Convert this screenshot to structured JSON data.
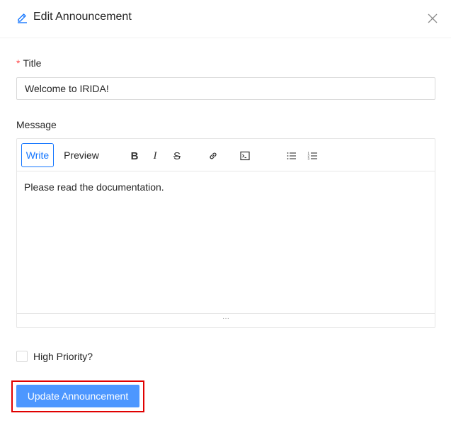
{
  "modal": {
    "title": "Edit Announcement",
    "icons": {
      "edit": "edit-pencil-icon",
      "close": "close-icon"
    }
  },
  "form": {
    "title_label": "Title",
    "title_required_mark": "*",
    "title_value": "Welcome to IRIDA!",
    "message_label": "Message",
    "editor": {
      "tabs": [
        "Write",
        "Preview"
      ],
      "active_tab": "Write",
      "toolbar": {
        "bold": "B",
        "italic": "I",
        "strikethrough": "S",
        "link_icon": "link-icon",
        "code_icon": "terminal-icon",
        "ul_icon": "unordered-list-icon",
        "ol_icon": "ordered-list-icon"
      },
      "content": "Please read the documentation.",
      "resize_handle": "···"
    },
    "priority_label": "High Priority?",
    "priority_checked": false,
    "submit_label": "Update Announcement"
  },
  "colors": {
    "primary": "#4d97ff",
    "active_tab": "#1677ff",
    "required": "#ff4d4f",
    "highlight": "#e00000"
  }
}
